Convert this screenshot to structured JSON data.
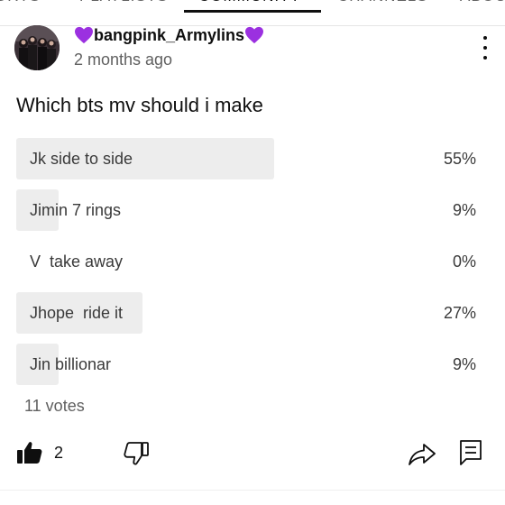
{
  "tabs": [
    {
      "label": "ORTS"
    },
    {
      "label": "PLAYLISTS"
    },
    {
      "label": "COMMUNITY",
      "active": true
    },
    {
      "label": "CHANNELS"
    },
    {
      "label": "ABOUT"
    }
  ],
  "post": {
    "author": "bangpink_Armylins",
    "author_emoji_icon": "purple-heart-icon",
    "time": "2 months ago",
    "question": "Which bts mv should i make"
  },
  "poll": {
    "options": [
      {
        "label": "Jk side to side",
        "percent_text": "55%",
        "percent": 55
      },
      {
        "label": "Jimin 7 rings",
        "percent_text": "9%",
        "percent": 9
      },
      {
        "label": "V  take away",
        "percent_text": "0%",
        "percent": 0
      },
      {
        "label": "Jhope  ride it",
        "percent_text": "27%",
        "percent": 27
      },
      {
        "label": "Jin billionar",
        "percent_text": "9%",
        "percent": 9
      }
    ],
    "votes": "11 votes"
  },
  "actions": {
    "like_count": "2",
    "like_icon": "thumbs-up-filled-icon",
    "dislike_icon": "thumbs-down-outline-icon",
    "share_icon": "share-arrow-icon",
    "comment_icon": "comment-icon"
  },
  "colors": {
    "poll_fill": "#ededed",
    "heart": "#9b30e0",
    "text_primary": "#0f0f0f",
    "text_secondary": "#606060"
  }
}
